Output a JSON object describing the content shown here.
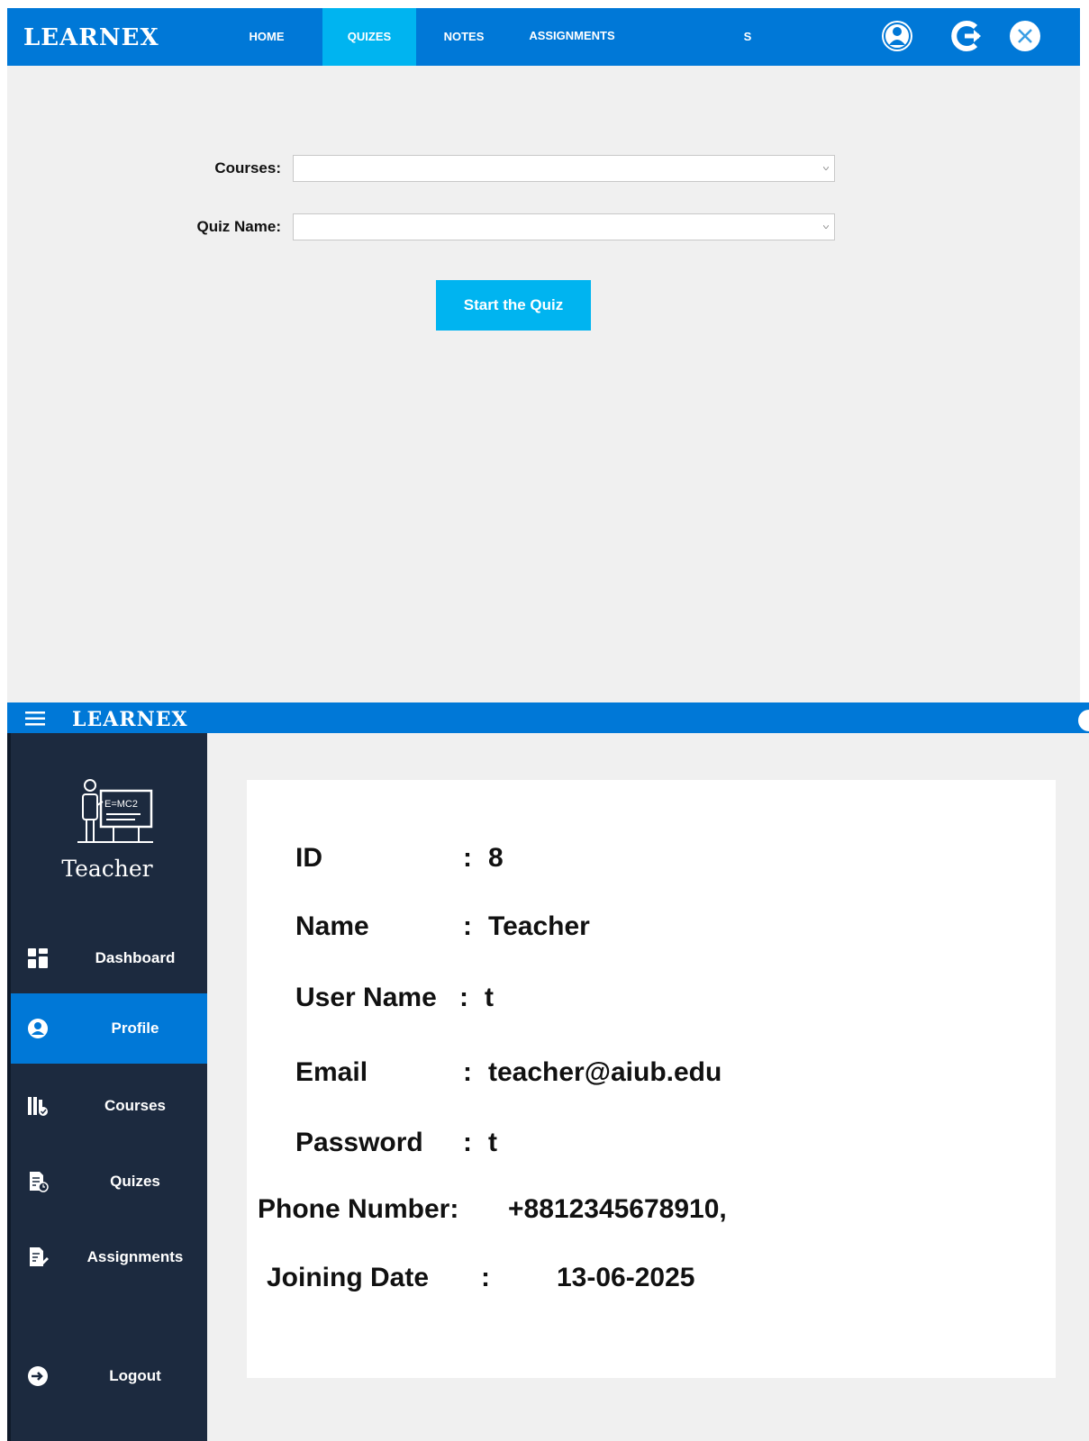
{
  "quiz_window": {
    "brand": "LEARNEX",
    "nav": {
      "home": "HOME",
      "quizes": "QUIZES",
      "notes": "NOTES",
      "assignments": "ASSIGNMENTS",
      "user": "S"
    },
    "icons": [
      "user-circle-icon",
      "logout-arrow-icon",
      "close-circle-icon"
    ],
    "form": {
      "courses_label": "Courses:",
      "courses_value": "",
      "quiz_name_label": "Quiz Name:",
      "quiz_name_value": "",
      "start_button": "Start the Quiz"
    }
  },
  "teacher_window": {
    "brand": "LEARNEX",
    "sidebar": {
      "role_label": "Teacher",
      "items": [
        {
          "label": "Dashboard",
          "icon": "dashboard-icon"
        },
        {
          "label": "Profile",
          "icon": "profile-icon"
        },
        {
          "label": "Courses",
          "icon": "courses-icon"
        },
        {
          "label": "Quizes",
          "icon": "quiz-icon"
        },
        {
          "label": "Assignments",
          "icon": "assignment-icon"
        },
        {
          "label": "Logout",
          "icon": "logout-icon"
        }
      ],
      "active_item": "Profile"
    },
    "profile": {
      "id_label": "ID",
      "id_colon": ":",
      "id_value": "8",
      "name_label": "Name",
      "name_colon": ":",
      "name_value": "Teacher",
      "username_label": "User Name",
      "username_colon": ":",
      "username_value": "t",
      "email_label": "Email",
      "email_colon": ":",
      "email_value": "teacher@aiub.edu",
      "password_label": "Password",
      "password_colon": ":",
      "password_value": "t",
      "phone_label": "Phone Number:",
      "phone_value": "+8812345678910,",
      "joining_label": "Joining Date",
      "joining_colon": ":",
      "joining_value": "13-06-2025"
    }
  },
  "colors": {
    "topbar_blue": "#0078d7",
    "active_tab": "#00b4f0",
    "sidebar_dark": "#1c2a3f",
    "window_bg": "#f0f0f0"
  }
}
